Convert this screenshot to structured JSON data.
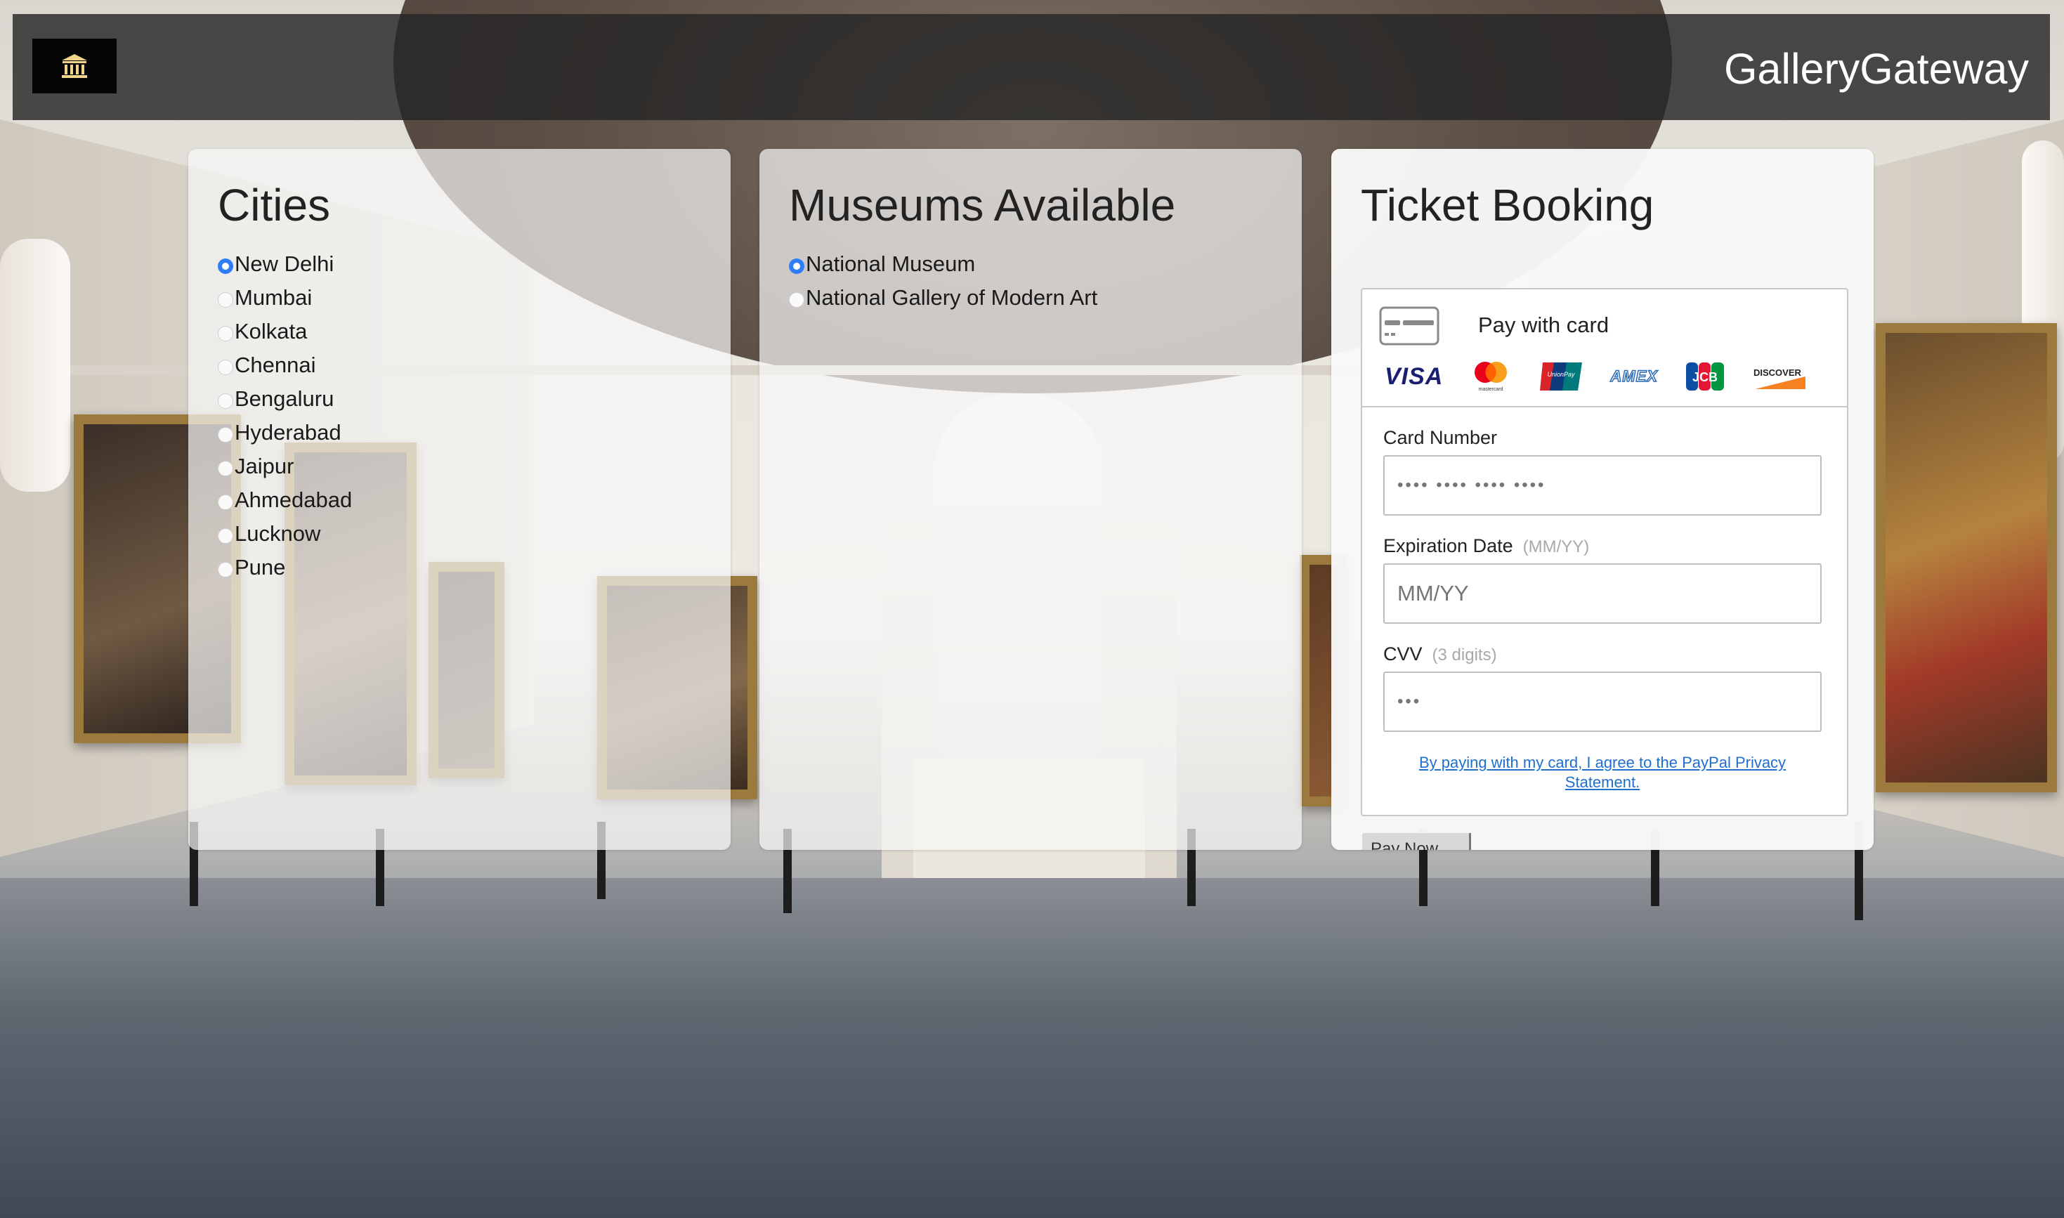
{
  "header": {
    "brand": "GalleryGateway"
  },
  "cities": {
    "title": "Cities",
    "selected": "New Delhi",
    "items": [
      "New Delhi",
      "Mumbai",
      "Kolkata",
      "Chennai",
      "Bengaluru",
      "Hyderabad",
      "Jaipur",
      "Ahmedabad",
      "Lucknow",
      "Pune"
    ]
  },
  "museums": {
    "title": "Museums Available",
    "selected": "National Museum",
    "items": [
      "National Museum",
      "National Gallery of Modern Art"
    ]
  },
  "booking": {
    "title": "Ticket Booking",
    "pay_title": "Pay with card",
    "card_brands": [
      "VISA",
      "mastercard",
      "UnionPay",
      "AMEX",
      "JCB",
      "DISCOVER"
    ],
    "card_number": {
      "label": "Card Number",
      "placeholder": "•••• •••• •••• ••••"
    },
    "expiration": {
      "label": "Expiration Date",
      "hint": "(MM/YY)",
      "placeholder": "MM/YY"
    },
    "cvv": {
      "label": "CVV",
      "hint": "(3 digits)",
      "placeholder": "•••"
    },
    "privacy_link": "By paying with my card, I agree to the PayPal Privacy Statement.",
    "pay_button": "Pay Now"
  },
  "colors": {
    "radio_selected": "#2e7df6",
    "link": "#1f6fd1",
    "header_bg": "#262626"
  }
}
